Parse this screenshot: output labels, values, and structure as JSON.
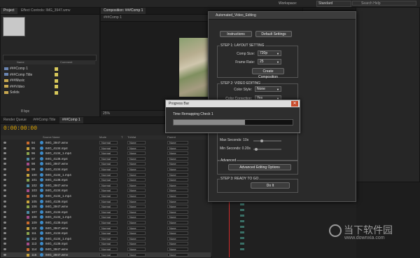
{
  "topbar": {
    "workspace_label": "Workspace:",
    "workspace_value": "Standard",
    "search_placeholder": "Search Help"
  },
  "project": {
    "tabs": [
      "Project",
      "Effect Controls: IMG_3947.wmv"
    ],
    "col_name": "Name",
    "col_comment": "Comment",
    "items": [
      {
        "label": "###Comp 1",
        "kind": "comp"
      },
      {
        "label": "###Comp Title",
        "kind": "comp"
      },
      {
        "label": "###Music",
        "kind": "folder"
      },
      {
        "label": "###Video",
        "kind": "folder"
      },
      {
        "label": "Solids",
        "kind": "folder"
      }
    ],
    "bpc": "8 bpc"
  },
  "viewer": {
    "tab": "Composition: ###Comp 1",
    "subtab": "###Comp 1",
    "zoom": "25%"
  },
  "timeline": {
    "tabs": [
      "Render Queue",
      "###Comp Title",
      "###Comp 1"
    ],
    "timecode": "0:00:00:00",
    "cols": {
      "source": "Source Name",
      "mode": "Mode",
      "t": "T",
      "trkmat": "TrkMat",
      "parent": "Parent"
    },
    "layers": [
      {
        "num": "94",
        "name": "IMG_3947.wmv",
        "mode": "Normal",
        "trk": "None",
        "parent": "None",
        "color": "#c96a2d"
      },
      {
        "num": "95",
        "name": "IMG_4134.mp4",
        "mode": "Normal",
        "trk": "None",
        "parent": "None",
        "color": "#c9a43b"
      },
      {
        "num": "96",
        "name": "IMG_4134_1.mp4",
        "mode": "Normal",
        "trk": "None",
        "parent": "None",
        "color": "#8aa44c"
      },
      {
        "num": "97",
        "name": "IMG_4136.mp4",
        "mode": "Normal",
        "trk": "None",
        "parent": "None",
        "color": "#4c8aa4"
      },
      {
        "num": "98",
        "name": "IMG_3947.wmv",
        "mode": "Normal",
        "trk": "None",
        "parent": "None",
        "color": "#a44c8a"
      },
      {
        "num": "99",
        "name": "IMG_4134.mp4",
        "mode": "Normal",
        "trk": "None",
        "parent": "None",
        "color": "#c96a2d"
      },
      {
        "num": "100",
        "name": "IMG_4134_1.mp4",
        "mode": "Normal",
        "trk": "None",
        "parent": "None",
        "color": "#c9a43b"
      },
      {
        "num": "101",
        "name": "IMG_4136.mp4",
        "mode": "Normal",
        "trk": "None",
        "parent": "None",
        "color": "#8aa44c"
      },
      {
        "num": "102",
        "name": "IMG_3947.wmv",
        "mode": "Normal",
        "trk": "None",
        "parent": "None",
        "color": "#4c8aa4"
      },
      {
        "num": "103",
        "name": "IMG_4134.mp4",
        "mode": "Normal",
        "trk": "None",
        "parent": "None",
        "color": "#a44c8a"
      },
      {
        "num": "104",
        "name": "IMG_4134_1.mp4",
        "mode": "Normal",
        "trk": "None",
        "parent": "None",
        "color": "#c96a2d"
      },
      {
        "num": "105",
        "name": "IMG_4136.mp4",
        "mode": "Normal",
        "trk": "None",
        "parent": "None",
        "color": "#c9a43b"
      },
      {
        "num": "106",
        "name": "IMG_3947.wmv",
        "mode": "Normal",
        "trk": "None",
        "parent": "None",
        "color": "#8aa44c"
      },
      {
        "num": "107",
        "name": "IMG_4134.mp4",
        "mode": "Normal",
        "trk": "None",
        "parent": "None",
        "color": "#4c8aa4"
      },
      {
        "num": "108",
        "name": "IMG_4134_1.mp4",
        "mode": "Normal",
        "trk": "None",
        "parent": "None",
        "color": "#a44c8a"
      },
      {
        "num": "109",
        "name": "IMG_4136.mp4",
        "mode": "Normal",
        "trk": "None",
        "parent": "None",
        "color": "#c96a2d"
      },
      {
        "num": "110",
        "name": "IMG_3947.wmv",
        "mode": "Normal",
        "trk": "None",
        "parent": "None",
        "color": "#c9a43b"
      },
      {
        "num": "111",
        "name": "IMG_4134.mp4",
        "mode": "Normal",
        "trk": "None",
        "parent": "None",
        "color": "#8aa44c"
      },
      {
        "num": "112",
        "name": "IMG_4134_1.mp4",
        "mode": "Normal",
        "trk": "None",
        "parent": "None",
        "color": "#4c8aa4"
      },
      {
        "num": "113",
        "name": "IMG_4136.mp4",
        "mode": "Normal",
        "trk": "None",
        "parent": "None",
        "color": "#a44c8a"
      },
      {
        "num": "114",
        "name": "IMG_3947.wmv",
        "mode": "Normal",
        "trk": "None",
        "parent": "None",
        "color": "#c96a2d"
      },
      {
        "num": "115",
        "name": "IMG_3947.wmv",
        "mode": "Normal",
        "trk": "None",
        "parent": "None",
        "color": "#c9a43b",
        "selected": true
      }
    ]
  },
  "script": {
    "title": "Automated_Video_Editing",
    "instructions": "Instructions",
    "default_settings": "Default Settings",
    "step1": "STEP 1: LAYOUT SETTING",
    "comp_size_label": "Comp Size:",
    "comp_size_value": "720p",
    "frame_rate_label": "Frame Rate:",
    "frame_rate_value": "25",
    "create_comp": "Create Composition",
    "step2": "STEP 2: VIDEO EDITING",
    "color_style_label": "Color Style:",
    "color_style_value": "None",
    "color_correction_label": "Color Correction:",
    "color_correction_value": "Yes",
    "max_seconds": "Max Seconds: 10s",
    "min_seconds": "Min Seconds: 0.20s",
    "max_slider": 0.3,
    "min_slider": 0.1,
    "advanced": "Advanced",
    "advanced_btn": "Advanced Editing Options",
    "step3": "STEP 3: READY TO GO",
    "doit": "Do It"
  },
  "progress": {
    "title": "Progress Bar",
    "status": "Time Remapping Check 1",
    "value": 0.6,
    "close": "✕"
  },
  "watermark": {
    "brand": "当下软件园",
    "url": "www.downxia.com"
  }
}
